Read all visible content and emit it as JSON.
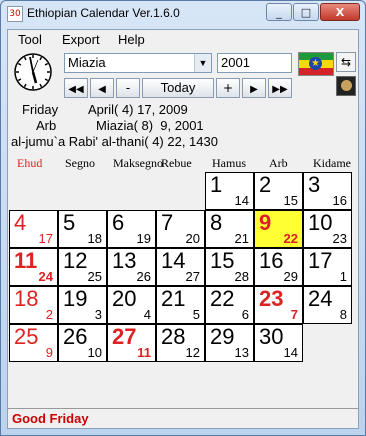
{
  "window": {
    "title": "Ethiopian Calendar Ver.1.6.0",
    "app_icon_text": "30",
    "min_label": "_",
    "max_label": "□",
    "close_label": "X"
  },
  "menu": {
    "tool": "Tool",
    "export": "Export",
    "help": "Help"
  },
  "controls": {
    "month": "Miazia",
    "year": "2001",
    "nav_first": "◀◀",
    "nav_prev": "◀",
    "minus": "-",
    "today": "Today",
    "plus": "+",
    "nav_next": "▶",
    "nav_last": "▶▶",
    "swap_icon": "⇆",
    "flag_emblem": "★"
  },
  "info": {
    "greg_day": "Friday",
    "greg_date": "April( 4) 17, 2009",
    "eth_day": "Arb",
    "eth_date": "Miazia( 8)  9, 2001",
    "hijri": "al-jumu`a Rabi' al-thani( 4) 22, 1430"
  },
  "weekdays": [
    "Ehud",
    "Segno",
    "Maksegno",
    "Rebue",
    "Hamus",
    "Arb",
    "Kidame"
  ],
  "colors": {
    "holiday_red": "#dd2222",
    "today_yellow": "#ffff33",
    "weekday_black": "#000000"
  },
  "days": [
    {
      "eth": "1",
      "greg": "14",
      "col": 4,
      "row": 0
    },
    {
      "eth": "2",
      "greg": "15",
      "col": 5,
      "row": 0
    },
    {
      "eth": "3",
      "greg": "16",
      "col": 6,
      "row": 0
    },
    {
      "eth": "4",
      "greg": "17",
      "col": 0,
      "row": 1,
      "red": true
    },
    {
      "eth": "5",
      "greg": "18",
      "col": 1,
      "row": 1
    },
    {
      "eth": "6",
      "greg": "19",
      "col": 2,
      "row": 1
    },
    {
      "eth": "7",
      "greg": "20",
      "col": 3,
      "row": 1
    },
    {
      "eth": "8",
      "greg": "21",
      "col": 4,
      "row": 1
    },
    {
      "eth": "9",
      "greg": "22",
      "col": 5,
      "row": 1,
      "red": true,
      "today": true,
      "bold": true
    },
    {
      "eth": "10",
      "greg": "23",
      "col": 6,
      "row": 1
    },
    {
      "eth": "11",
      "greg": "24",
      "col": 0,
      "row": 2,
      "red": true,
      "bold": true
    },
    {
      "eth": "12",
      "greg": "25",
      "col": 1,
      "row": 2
    },
    {
      "eth": "13",
      "greg": "26",
      "col": 2,
      "row": 2
    },
    {
      "eth": "14",
      "greg": "27",
      "col": 3,
      "row": 2
    },
    {
      "eth": "15",
      "greg": "28",
      "col": 4,
      "row": 2
    },
    {
      "eth": "16",
      "greg": "29",
      "col": 5,
      "row": 2
    },
    {
      "eth": "17",
      "greg": "1",
      "col": 6,
      "row": 2
    },
    {
      "eth": "18",
      "greg": "2",
      "col": 0,
      "row": 3,
      "red": true
    },
    {
      "eth": "19",
      "greg": "3",
      "col": 1,
      "row": 3
    },
    {
      "eth": "20",
      "greg": "4",
      "col": 2,
      "row": 3
    },
    {
      "eth": "21",
      "greg": "5",
      "col": 3,
      "row": 3
    },
    {
      "eth": "22",
      "greg": "6",
      "col": 4,
      "row": 3
    },
    {
      "eth": "23",
      "greg": "7",
      "col": 5,
      "row": 3,
      "red": true,
      "bold": true
    },
    {
      "eth": "24",
      "greg": "8",
      "col": 6,
      "row": 3
    },
    {
      "eth": "25",
      "greg": "9",
      "col": 0,
      "row": 4,
      "red": true
    },
    {
      "eth": "26",
      "greg": "10",
      "col": 1,
      "row": 4
    },
    {
      "eth": "27",
      "greg": "11",
      "col": 2,
      "row": 4,
      "red": true,
      "bold": true
    },
    {
      "eth": "28",
      "greg": "12",
      "col": 3,
      "row": 4
    },
    {
      "eth": "29",
      "greg": "13",
      "col": 4,
      "row": 4
    },
    {
      "eth": "30",
      "greg": "14",
      "col": 5,
      "row": 4
    }
  ],
  "status": "Good Friday"
}
